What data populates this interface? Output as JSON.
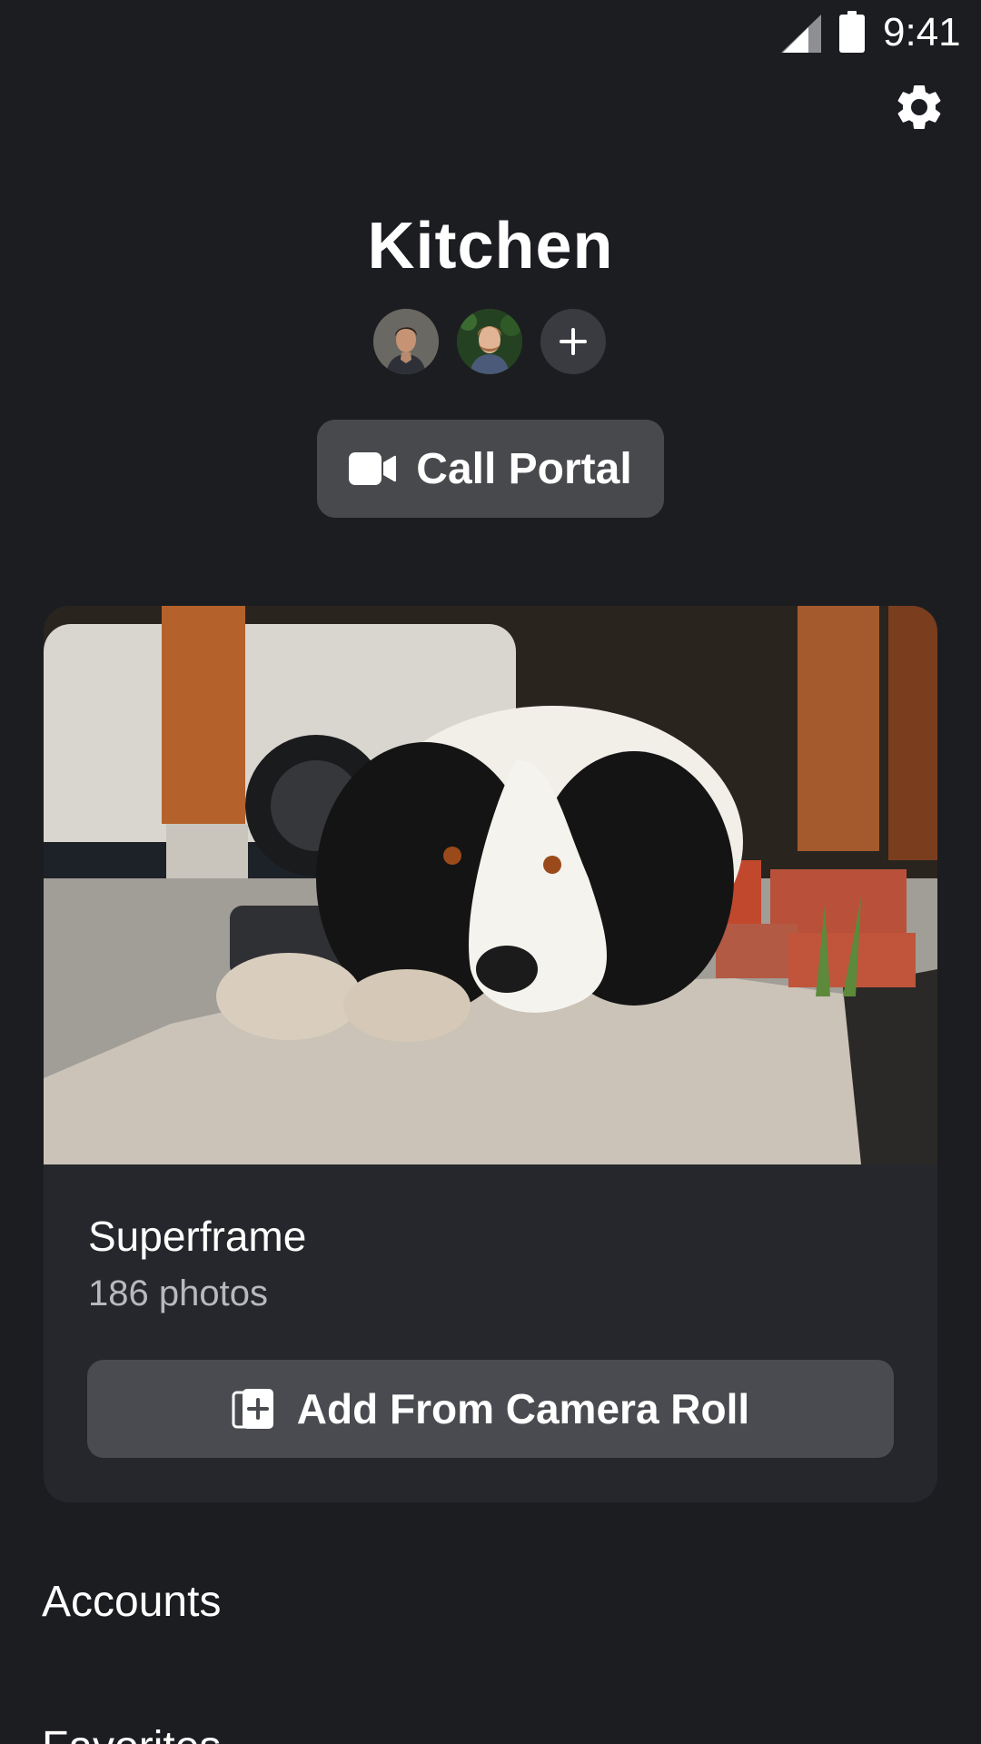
{
  "status_bar": {
    "time": "9:41",
    "icons": [
      "signal-icon",
      "battery-icon"
    ]
  },
  "header": {
    "settings_icon": "gear-icon",
    "title": "Kitchen"
  },
  "members": {
    "avatars": [
      "avatar-man-dark-hair",
      "avatar-man-beard"
    ],
    "add_icon": "plus-icon"
  },
  "call_button": {
    "icon": "video-camera-icon",
    "label": "Call Portal"
  },
  "superframe": {
    "photo": "dog-photo",
    "title": "Superframe",
    "count": "186 photos",
    "add_button": {
      "icon": "add-photo-icon",
      "label": "Add From Camera Roll"
    }
  },
  "sections": {
    "accounts": "Accounts",
    "next": "Favorites"
  },
  "colors": {
    "background": "#1c1d21",
    "card": "#26272c",
    "button": "#48494d",
    "text": "#ffffff",
    "muted_text": "#b8b9be"
  }
}
